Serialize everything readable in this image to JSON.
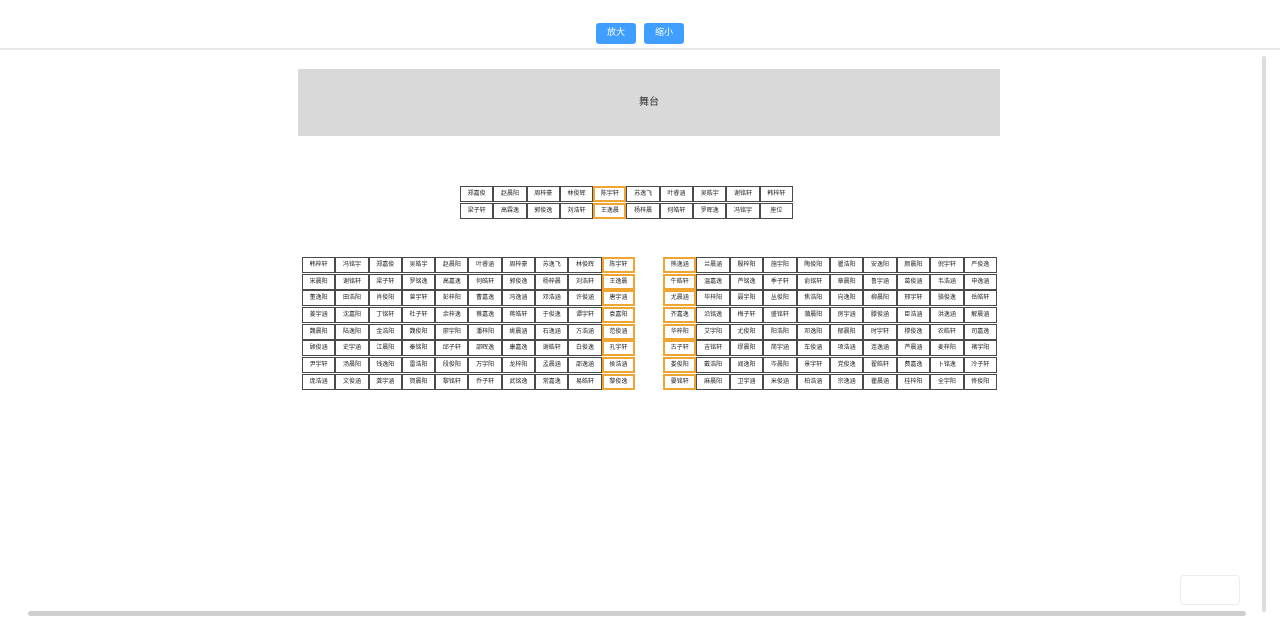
{
  "toolbar": {
    "zoom_in": "放大",
    "zoom_out": "缩小"
  },
  "stage": {
    "label": "舞台"
  },
  "front_rows": [
    [
      {
        "n": "郑嘉俊"
      },
      {
        "n": "赵晨阳"
      },
      {
        "n": "周梓豪"
      },
      {
        "n": "林俊辉"
      },
      {
        "n": "陈宇轩",
        "s": true
      },
      {
        "n": "苏逸飞"
      },
      {
        "n": "叶睿涵"
      },
      {
        "n": "吴皓宇"
      },
      {
        "n": "谢铭轩"
      },
      {
        "n": "韩梓轩"
      }
    ],
    [
      {
        "n": "梁子轩"
      },
      {
        "n": "高霖逸"
      },
      {
        "n": "郭俊逸"
      },
      {
        "n": "刘浩轩"
      },
      {
        "n": "王逸晨",
        "s": true
      },
      {
        "n": "杨梓晨"
      },
      {
        "n": "何皓轩"
      },
      {
        "n": "罗晖逸"
      },
      {
        "n": "冯铭宇"
      },
      {
        "n": "座位"
      }
    ]
  ],
  "left_rows": [
    [
      {
        "n": "韩梓轩"
      },
      {
        "n": "冯铭宇"
      },
      {
        "n": "郑嘉俊"
      },
      {
        "n": "吴皓宇"
      },
      {
        "n": "赵晨阳"
      },
      {
        "n": "叶睿涵"
      },
      {
        "n": "周梓豪"
      },
      {
        "n": "苏逸飞"
      },
      {
        "n": "林俊辉"
      },
      {
        "n": "陈宇轩",
        "s": true
      }
    ],
    [
      {
        "n": "宋晨阳"
      },
      {
        "n": "谢铭轩"
      },
      {
        "n": "梁子轩"
      },
      {
        "n": "罗铭逸"
      },
      {
        "n": "高嘉逸"
      },
      {
        "n": "何皓轩"
      },
      {
        "n": "郭俊逸"
      },
      {
        "n": "杨梓晨"
      },
      {
        "n": "刘浩轩"
      },
      {
        "n": "王逸晨",
        "s": true
      }
    ],
    [
      {
        "n": "董逸阳"
      },
      {
        "n": "田浩阳"
      },
      {
        "n": "肖俊阳"
      },
      {
        "n": "曾宇轩"
      },
      {
        "n": "彭梓阳"
      },
      {
        "n": "曹嘉逸"
      },
      {
        "n": "冯逸涵"
      },
      {
        "n": "邓浩涵"
      },
      {
        "n": "许俊涵"
      },
      {
        "n": "唐宇涵",
        "s": true
      }
    ],
    [
      {
        "n": "姜宇涵"
      },
      {
        "n": "沈嘉阳"
      },
      {
        "n": "丁铭轩"
      },
      {
        "n": "杜子轩"
      },
      {
        "n": "余梓逸"
      },
      {
        "n": "蔡嘉逸"
      },
      {
        "n": "蒋皓轩"
      },
      {
        "n": "于俊逸"
      },
      {
        "n": "谭宇轩"
      },
      {
        "n": "袁嘉阳",
        "s": true
      }
    ],
    [
      {
        "n": "魏晨阳"
      },
      {
        "n": "陆逸阳"
      },
      {
        "n": "金浩阳"
      },
      {
        "n": "魏俊阳"
      },
      {
        "n": "廖宇阳"
      },
      {
        "n": "潘梓阳"
      },
      {
        "n": "姚晨涵"
      },
      {
        "n": "石逸涵"
      },
      {
        "n": "方浩涵"
      },
      {
        "n": "范俊涵",
        "s": true
      }
    ],
    [
      {
        "n": "顾俊涵"
      },
      {
        "n": "史宇涵"
      },
      {
        "n": "江晨阳"
      },
      {
        "n": "秦铭阳"
      },
      {
        "n": "邱子轩"
      },
      {
        "n": "邵晖逸"
      },
      {
        "n": "康嘉逸"
      },
      {
        "n": "谢皓轩"
      },
      {
        "n": "白俊逸"
      },
      {
        "n": "孔宇轩",
        "s": true
      }
    ],
    [
      {
        "n": "尹宇轩"
      },
      {
        "n": "汤晨阳"
      },
      {
        "n": "钱逸阳"
      },
      {
        "n": "雷浩阳"
      },
      {
        "n": "段俊阳"
      },
      {
        "n": "万宇阳"
      },
      {
        "n": "龙梓阳"
      },
      {
        "n": "孟晨涵"
      },
      {
        "n": "邵逸涵"
      },
      {
        "n": "侯浩涵",
        "s": true
      }
    ],
    [
      {
        "n": "庞浩涵"
      },
      {
        "n": "文俊涵"
      },
      {
        "n": "龚宇涵"
      },
      {
        "n": "賀晨阳"
      },
      {
        "n": "黎铭轩"
      },
      {
        "n": "乔子轩"
      },
      {
        "n": "武铭逸"
      },
      {
        "n": "常嘉逸"
      },
      {
        "n": "易皓轩"
      },
      {
        "n": "黎俊逸",
        "s": true
      }
    ]
  ],
  "right_rows": [
    [
      {
        "n": "熊逸涵",
        "s": true
      },
      {
        "n": "兰晨涵"
      },
      {
        "n": "殷梓阳"
      },
      {
        "n": "施宇阳"
      },
      {
        "n": "陶俊阳"
      },
      {
        "n": "瞿浩阳"
      },
      {
        "n": "安逸阳"
      },
      {
        "n": "颜晨阳"
      },
      {
        "n": "倪宇轩"
      },
      {
        "n": "严俊逸"
      }
    ],
    [
      {
        "n": "牛皓轩",
        "s": true
      },
      {
        "n": "温嘉逸"
      },
      {
        "n": "芦铭逸"
      },
      {
        "n": "季子轩"
      },
      {
        "n": "俞铭轩"
      },
      {
        "n": "章晨阳"
      },
      {
        "n": "鲁宇涵"
      },
      {
        "n": "葛俊涵"
      },
      {
        "n": "韦浩涵"
      },
      {
        "n": "申逸涵"
      }
    ],
    [
      {
        "n": "尤晨涵",
        "s": true
      },
      {
        "n": "毕梓阳"
      },
      {
        "n": "聂宇阳"
      },
      {
        "n": "丛俊阳"
      },
      {
        "n": "焦浩阳"
      },
      {
        "n": "向逸阳"
      },
      {
        "n": "柳晨阳"
      },
      {
        "n": "邢宇轩"
      },
      {
        "n": "骆俊逸"
      },
      {
        "n": "岳皓轩"
      }
    ],
    [
      {
        "n": "齐嘉逸",
        "s": true
      },
      {
        "n": "沿铭逸"
      },
      {
        "n": "梅子轩"
      },
      {
        "n": "盛铭轩"
      },
      {
        "n": "蒲晨阳"
      },
      {
        "n": "房宇涵"
      },
      {
        "n": "滕俊涵"
      },
      {
        "n": "臣浩涵"
      },
      {
        "n": "洪逸涵"
      },
      {
        "n": "解晨涵"
      }
    ],
    [
      {
        "n": "华梓阳",
        "s": true
      },
      {
        "n": "艾宇阳"
      },
      {
        "n": "尤俊阳"
      },
      {
        "n": "阳浩阳"
      },
      {
        "n": "邓逸阳"
      },
      {
        "n": "郁晨阳"
      },
      {
        "n": "时宇轩"
      },
      {
        "n": "穆俊逸"
      },
      {
        "n": "农皓轩"
      },
      {
        "n": "司嘉逸"
      }
    ],
    [
      {
        "n": "古子轩",
        "s": true
      },
      {
        "n": "吉铭轩"
      },
      {
        "n": "缪晨阳"
      },
      {
        "n": "简宇涵"
      },
      {
        "n": "车俊涵"
      },
      {
        "n": "项浩涵"
      },
      {
        "n": "连逸涵"
      },
      {
        "n": "芦晨涵"
      },
      {
        "n": "麦梓阳"
      },
      {
        "n": "褚宇阳"
      }
    ],
    [
      {
        "n": "娄俊阳",
        "s": true
      },
      {
        "n": "戴浩阳"
      },
      {
        "n": "阎逸阳"
      },
      {
        "n": "岑晨阳"
      },
      {
        "n": "景宇轩"
      },
      {
        "n": "党俊逸"
      },
      {
        "n": "翟皓轩"
      },
      {
        "n": "费嘉逸"
      },
      {
        "n": "卜铭逸"
      },
      {
        "n": "冷子轩"
      }
    ],
    [
      {
        "n": "晏铭轩",
        "s": true
      },
      {
        "n": "麻晨阳"
      },
      {
        "n": "卫宇涵"
      },
      {
        "n": "米俊涵"
      },
      {
        "n": "柏浩涵"
      },
      {
        "n": "宗逸涵"
      },
      {
        "n": "瞿晨涵"
      },
      {
        "n": "桂梓阳"
      },
      {
        "n": "全宇阳"
      },
      {
        "n": "佟俊阳"
      }
    ]
  ]
}
